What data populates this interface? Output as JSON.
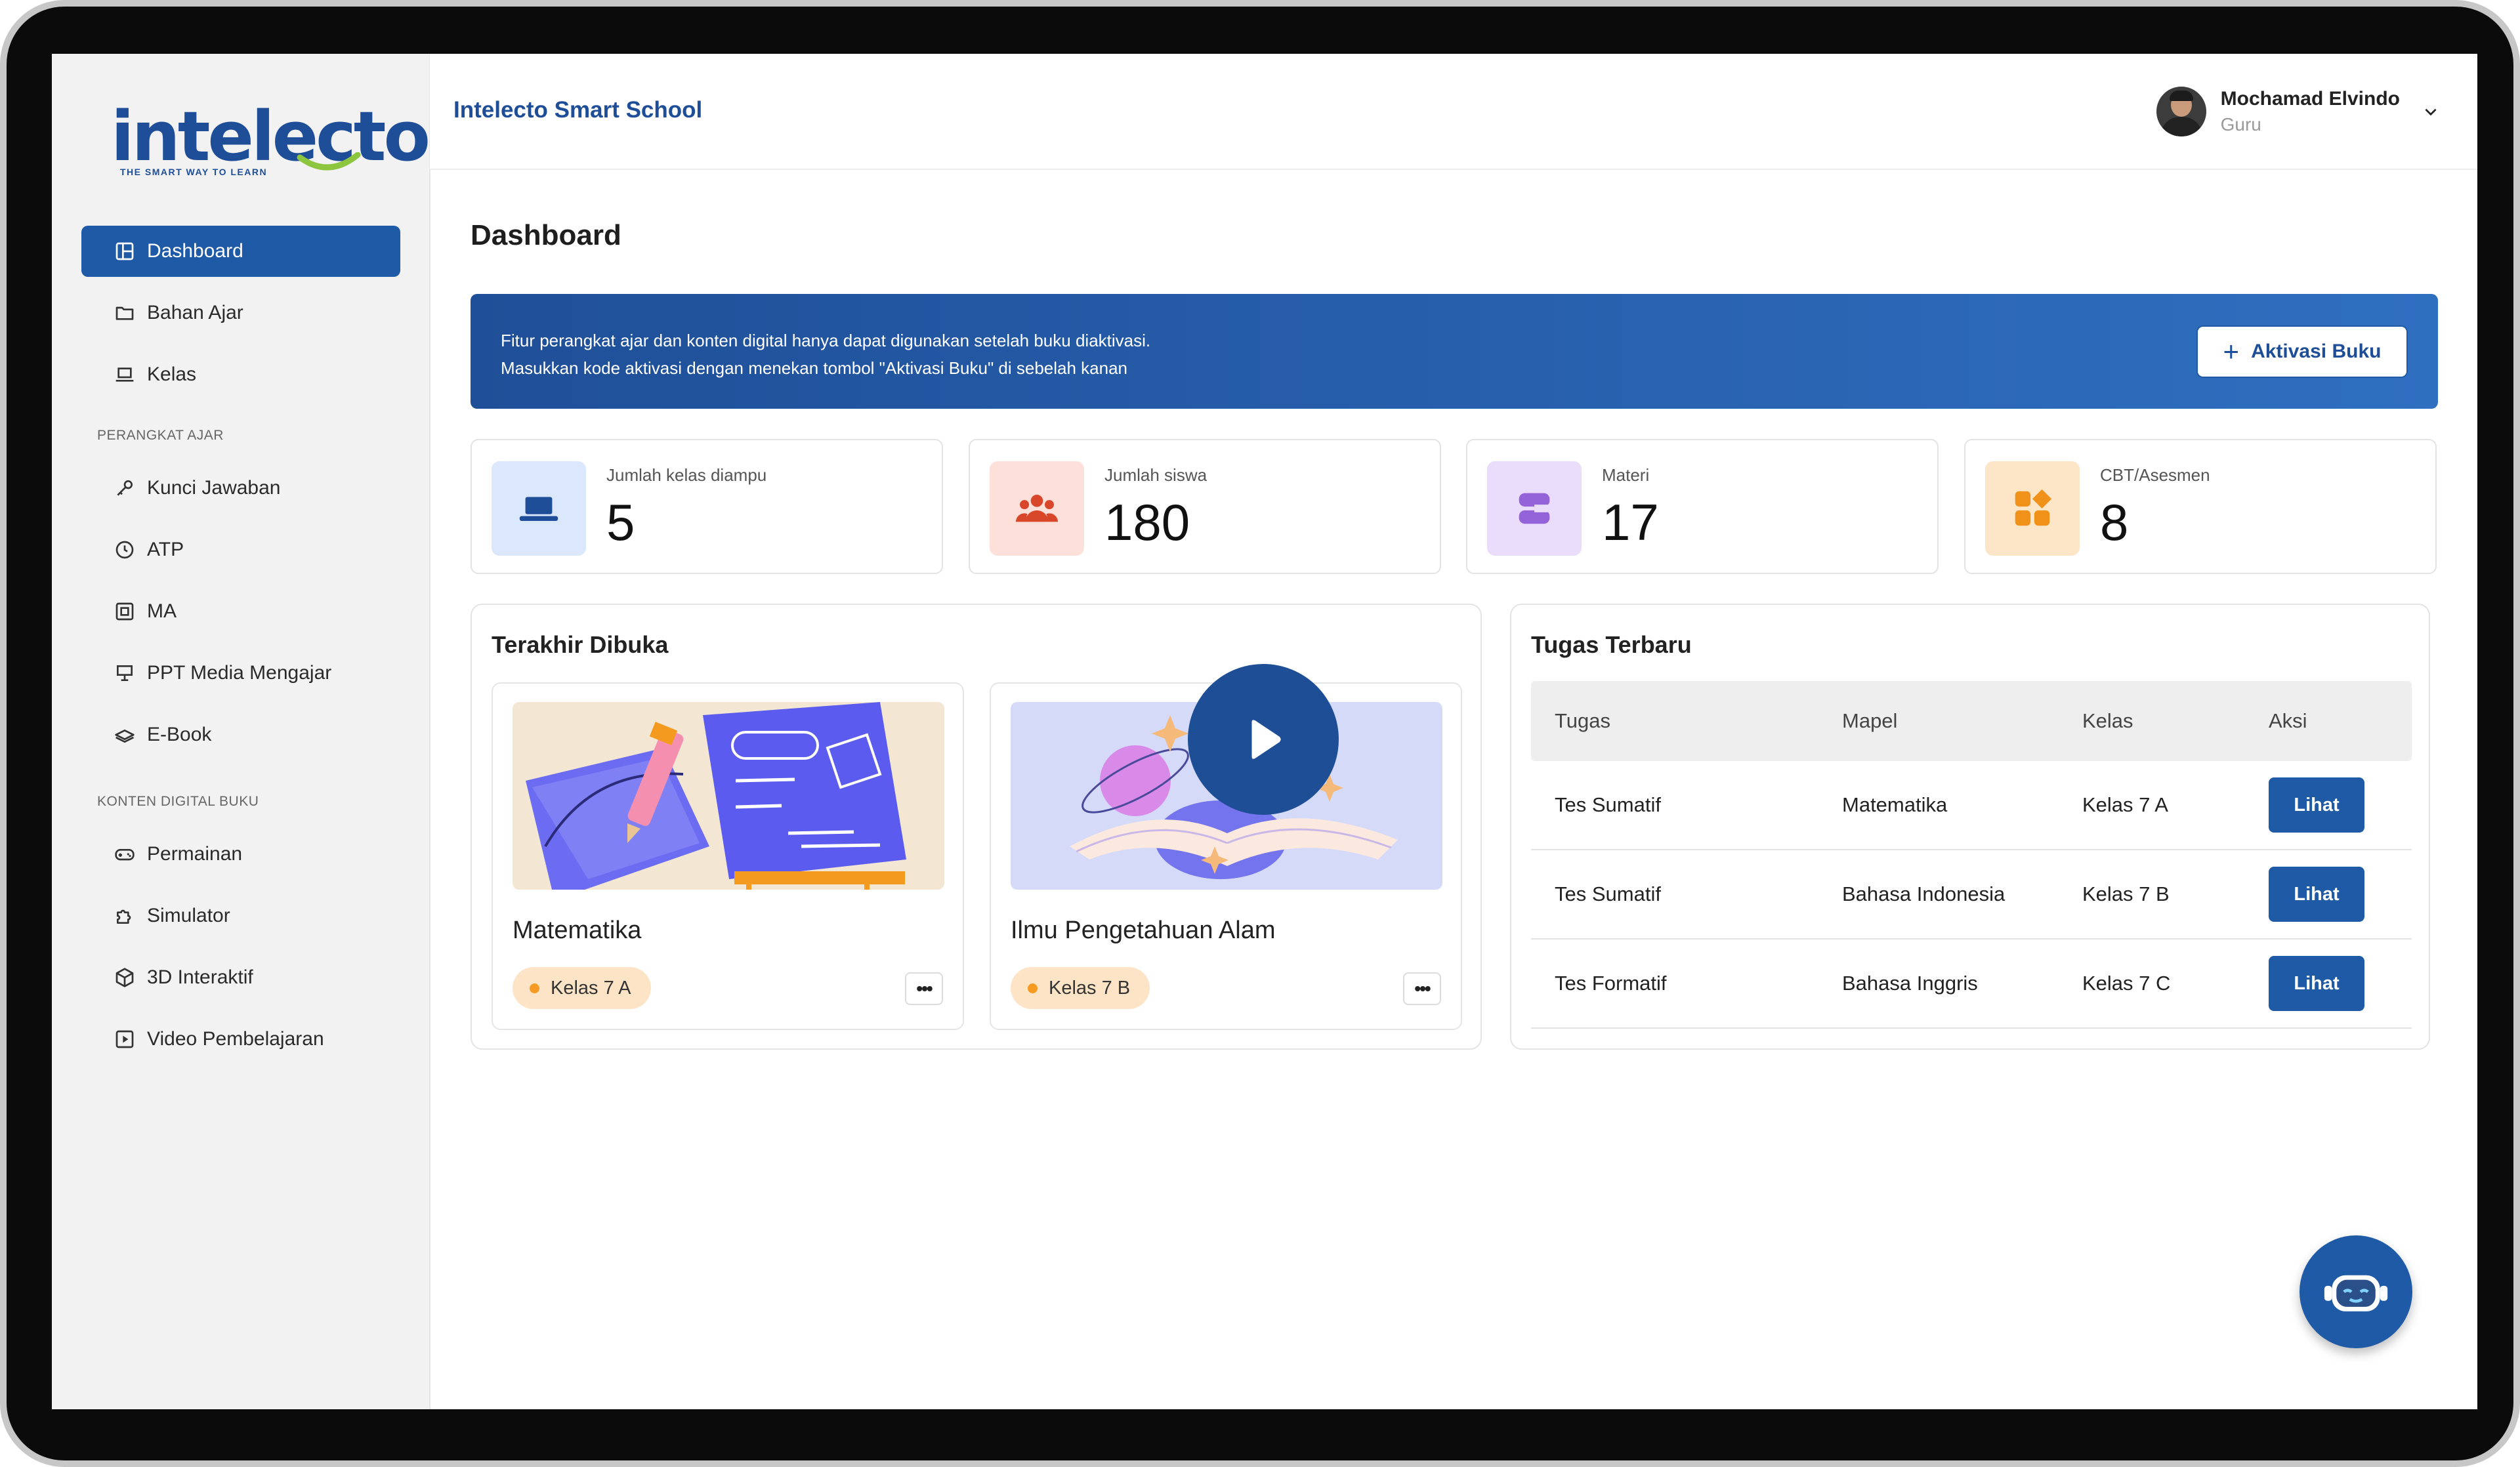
{
  "app": {
    "brand": "Intelecto Smart School",
    "logo_word": "intelecto",
    "logo_tagline": "THE SMART WAY TO LEARN"
  },
  "user": {
    "name": "Mochamad Elvindo",
    "role": "Guru"
  },
  "sidebar": {
    "items": [
      {
        "label": "Dashboard",
        "icon": "dashboard-icon",
        "active": true
      },
      {
        "label": "Bahan Ajar",
        "icon": "folder-icon"
      },
      {
        "label": "Kelas",
        "icon": "laptop-icon"
      }
    ],
    "section_perangkat": "PERANGKAT AJAR",
    "perangkat_items": [
      {
        "label": "Kunci Jawaban",
        "icon": "key-icon"
      },
      {
        "label": "ATP",
        "icon": "clock-icon"
      },
      {
        "label": "MA",
        "icon": "module-icon"
      },
      {
        "label": "PPT Media Mengajar",
        "icon": "presentation-icon"
      },
      {
        "label": "E-Book",
        "icon": "ebook-icon"
      }
    ],
    "section_konten": "KONTEN DIGITAL BUKU",
    "konten_items": [
      {
        "label": "Permainan",
        "icon": "gamepad-icon"
      },
      {
        "label": "Simulator",
        "icon": "puzzle-icon"
      },
      {
        "label": "3D Interaktif",
        "icon": "cube-icon"
      },
      {
        "label": "Video Pembelajaran",
        "icon": "video-icon"
      }
    ]
  },
  "page": {
    "title": "Dashboard"
  },
  "banner": {
    "line1": "Fitur perangkat ajar dan konten digital hanya dapat digunakan setelah buku diaktivasi.",
    "line2": "Masukkan kode aktivasi dengan menekan tombol \"Aktivasi Buku\" di sebelah kanan",
    "button": "Aktivasi Buku"
  },
  "stats": [
    {
      "label": "Jumlah kelas diampu",
      "value": "5",
      "icon": "laptop-icon",
      "bg": "#dbe7fb",
      "fg": "#1f4e99"
    },
    {
      "label": "Jumlah siswa",
      "value": "180",
      "icon": "users-icon",
      "bg": "#fde0da",
      "fg": "#d9472b"
    },
    {
      "label": "Materi",
      "value": "17",
      "icon": "layers-icon",
      "bg": "#eadcfb",
      "fg": "#9462d9"
    },
    {
      "label": "CBT/Asesmen",
      "value": "8",
      "icon": "apps-icon",
      "bg": "#fde6c8",
      "fg": "#f0911a"
    }
  ],
  "recent": {
    "title": "Terakhir Dibuka",
    "items": [
      {
        "name": "Matematika",
        "tag": "Kelas 7 A"
      },
      {
        "name": "Ilmu Pengetahuan Alam",
        "tag": "Kelas 7 B"
      }
    ],
    "more": "•••"
  },
  "tasks": {
    "title": "Tugas Terbaru",
    "headers": [
      "Tugas",
      "Mapel",
      "Kelas",
      "Aksi"
    ],
    "rows": [
      {
        "tugas": "Tes Sumatif",
        "mapel": "Matematika",
        "kelas": "Kelas 7 A",
        "aksi": "Lihat"
      },
      {
        "tugas": "Tes Sumatif",
        "mapel": "Bahasa Indonesia",
        "kelas": "Kelas 7 B",
        "aksi": "Lihat"
      },
      {
        "tugas": "Tes Formatif",
        "mapel": "Bahasa Inggris",
        "kelas": "Kelas 7 C",
        "aksi": "Lihat"
      }
    ]
  },
  "colors": {
    "primary": "#1f5aa6",
    "brand": "#1f4e99",
    "accent_green": "#8cc63f"
  }
}
